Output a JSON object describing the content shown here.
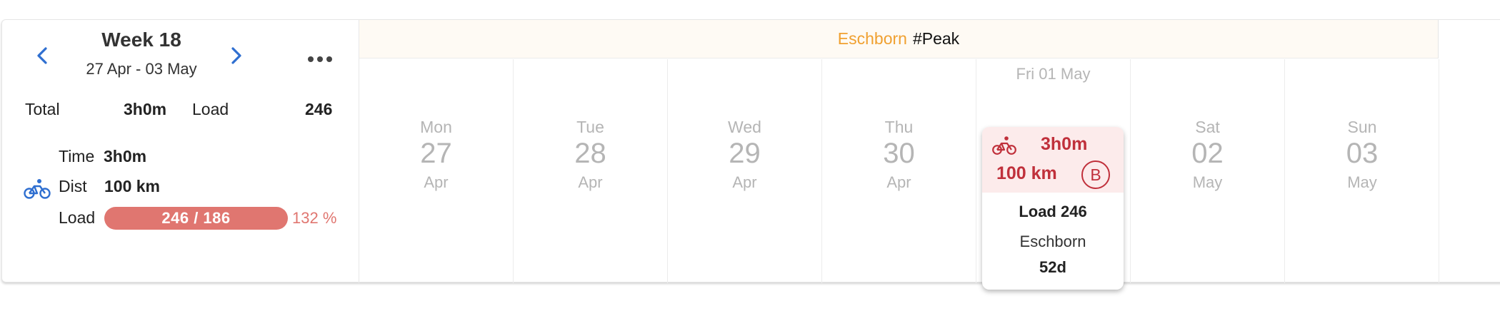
{
  "week": {
    "title": "Week 18",
    "range": "27 Apr - 03 May"
  },
  "totals": {
    "total_label": "Total",
    "total_value": "3h0m",
    "load_label": "Load",
    "load_value": "246"
  },
  "sport_summary": {
    "icon": "bike-icon",
    "time_label": "Time",
    "time_value": "3h0m",
    "dist_label": "Dist",
    "dist_value": "100 km",
    "load_label": "Load",
    "load_bar_text": "246 / 186",
    "load_percent": "132 %"
  },
  "event_banner": {
    "location": "Eschborn",
    "tag": "#Peak"
  },
  "days": [
    {
      "name": "Mon",
      "num": "27",
      "month": "Apr"
    },
    {
      "name": "Tue",
      "num": "28",
      "month": "Apr"
    },
    {
      "name": "Wed",
      "num": "29",
      "month": "Apr"
    },
    {
      "name": "Thu",
      "num": "30",
      "month": "Apr"
    },
    {
      "name": "Fri 01 May"
    },
    {
      "name": "Sat",
      "num": "02",
      "month": "May"
    },
    {
      "name": "Sun",
      "num": "03",
      "month": "May"
    }
  ],
  "workout": {
    "icon": "bike-icon",
    "time": "3h0m",
    "distance": "100 km",
    "priority": "B",
    "load": "Load 246",
    "location": "Eschborn",
    "days_out": "52d"
  },
  "colors": {
    "accent_blue": "#2f6fd0",
    "race_red": "#c0303b",
    "load_bar": "#e07670",
    "event_orange": "#f0a030",
    "muted": "#b5b5b5"
  }
}
